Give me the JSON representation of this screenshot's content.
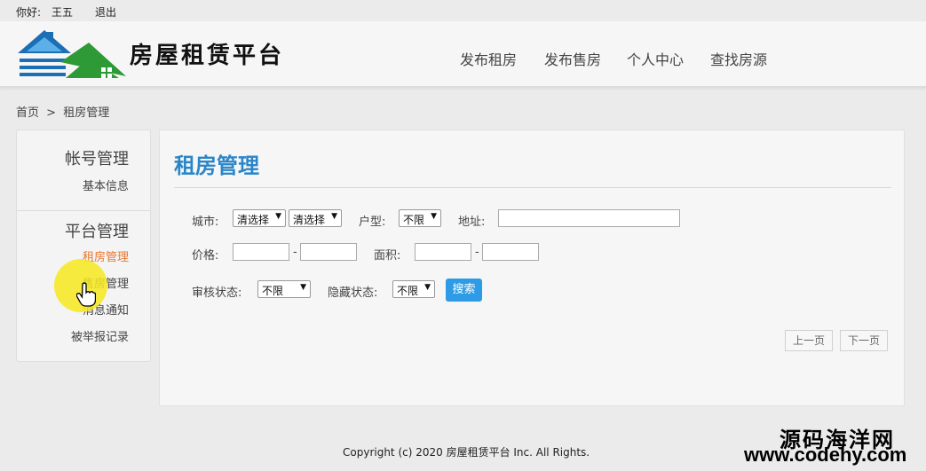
{
  "topbar": {
    "greeting": "你好:",
    "username": "王五",
    "logout": "退出"
  },
  "header": {
    "site_title": "房屋租赁平台",
    "nav": [
      "发布租房",
      "发布售房",
      "个人中心",
      "查找房源"
    ]
  },
  "breadcrumb": {
    "home": "首页",
    "sep": ">",
    "current": "租房管理"
  },
  "sidebar": {
    "group1": {
      "title": "帐号管理",
      "items": [
        "基本信息"
      ]
    },
    "group2": {
      "title": "平台管理",
      "items": [
        "租房管理",
        "售房管理",
        "消息通知",
        "被举报记录"
      ]
    },
    "active_item": "租房管理"
  },
  "main": {
    "title": "租房管理",
    "filters": {
      "city_label": "城市:",
      "city_select1": "清选择",
      "city_select2": "清选择",
      "layout_label": "户型:",
      "layout_value": "不限",
      "address_label": "地址:",
      "address_value": "",
      "price_label": "价格:",
      "price_min": "",
      "price_max": "",
      "area_label": "面积:",
      "area_min": "",
      "area_max": "",
      "range_sep": "-",
      "review_label": "审核状态:",
      "review_value": "不限",
      "hidden_label": "隐藏状态:",
      "hidden_value": "不限",
      "search_button": "搜索"
    },
    "pagination": {
      "prev": "上一页",
      "next": "下一页"
    }
  },
  "footer": {
    "copyright": "Copyright (c) 2020 房屋租赁平台 Inc. All Rights."
  },
  "watermark": {
    "line1": "源码海洋网",
    "line2": "www.codehy.com"
  },
  "colors": {
    "accent_blue": "#2a86c8",
    "button_blue": "#2d9be6",
    "active_orange": "#e8772e",
    "cursor_yellow": "#f7e71e"
  }
}
